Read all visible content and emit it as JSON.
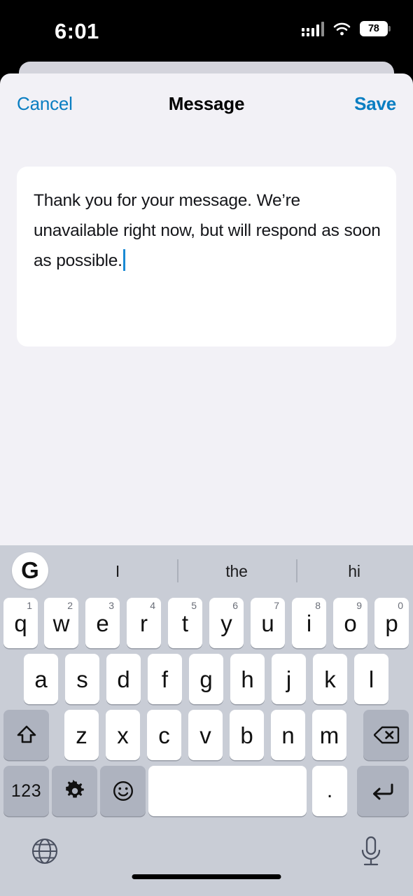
{
  "status_bar": {
    "time": "6:01",
    "battery_level": "78",
    "icons": [
      "signal-bars-icon",
      "wifi-icon",
      "battery-icon"
    ]
  },
  "nav_bar": {
    "cancel_label": "Cancel",
    "title": "Message",
    "save_label": "Save",
    "accent_color": "#0a7ec2"
  },
  "message_editor": {
    "value": "Thank you for your message. We’re unavailable right now, but will respond as soon as possible.",
    "placeholder": "Message",
    "caret_color": "#1a8ad4",
    "background": "#ffffff"
  },
  "keyboard": {
    "background": "#c9cdd6",
    "logo": "G",
    "suggestions": [
      "I",
      "the",
      "hi"
    ],
    "row1": [
      {
        "letter": "q",
        "num": "1"
      },
      {
        "letter": "w",
        "num": "2"
      },
      {
        "letter": "e",
        "num": "3"
      },
      {
        "letter": "r",
        "num": "4"
      },
      {
        "letter": "t",
        "num": "5"
      },
      {
        "letter": "y",
        "num": "6"
      },
      {
        "letter": "u",
        "num": "7"
      },
      {
        "letter": "i",
        "num": "8"
      },
      {
        "letter": "o",
        "num": "9"
      },
      {
        "letter": "p",
        "num": "0"
      }
    ],
    "row2": [
      {
        "letter": "a"
      },
      {
        "letter": "s"
      },
      {
        "letter": "d"
      },
      {
        "letter": "f"
      },
      {
        "letter": "g"
      },
      {
        "letter": "h"
      },
      {
        "letter": "j"
      },
      {
        "letter": "k"
      },
      {
        "letter": "l"
      }
    ],
    "row3": [
      {
        "letter": "z"
      },
      {
        "letter": "x"
      },
      {
        "letter": "c"
      },
      {
        "letter": "v"
      },
      {
        "letter": "b"
      },
      {
        "letter": "n"
      },
      {
        "letter": "m"
      }
    ],
    "shift_key": "shift-icon",
    "backspace_key": "backspace-icon",
    "numeric_key": "123",
    "settings_key": "gear-icon",
    "emoji_key": "emoji-icon",
    "space_key": "",
    "period_key": ".",
    "enter_key": "enter-icon",
    "globe_key": "globe-icon",
    "mic_key": "microphone-icon"
  }
}
